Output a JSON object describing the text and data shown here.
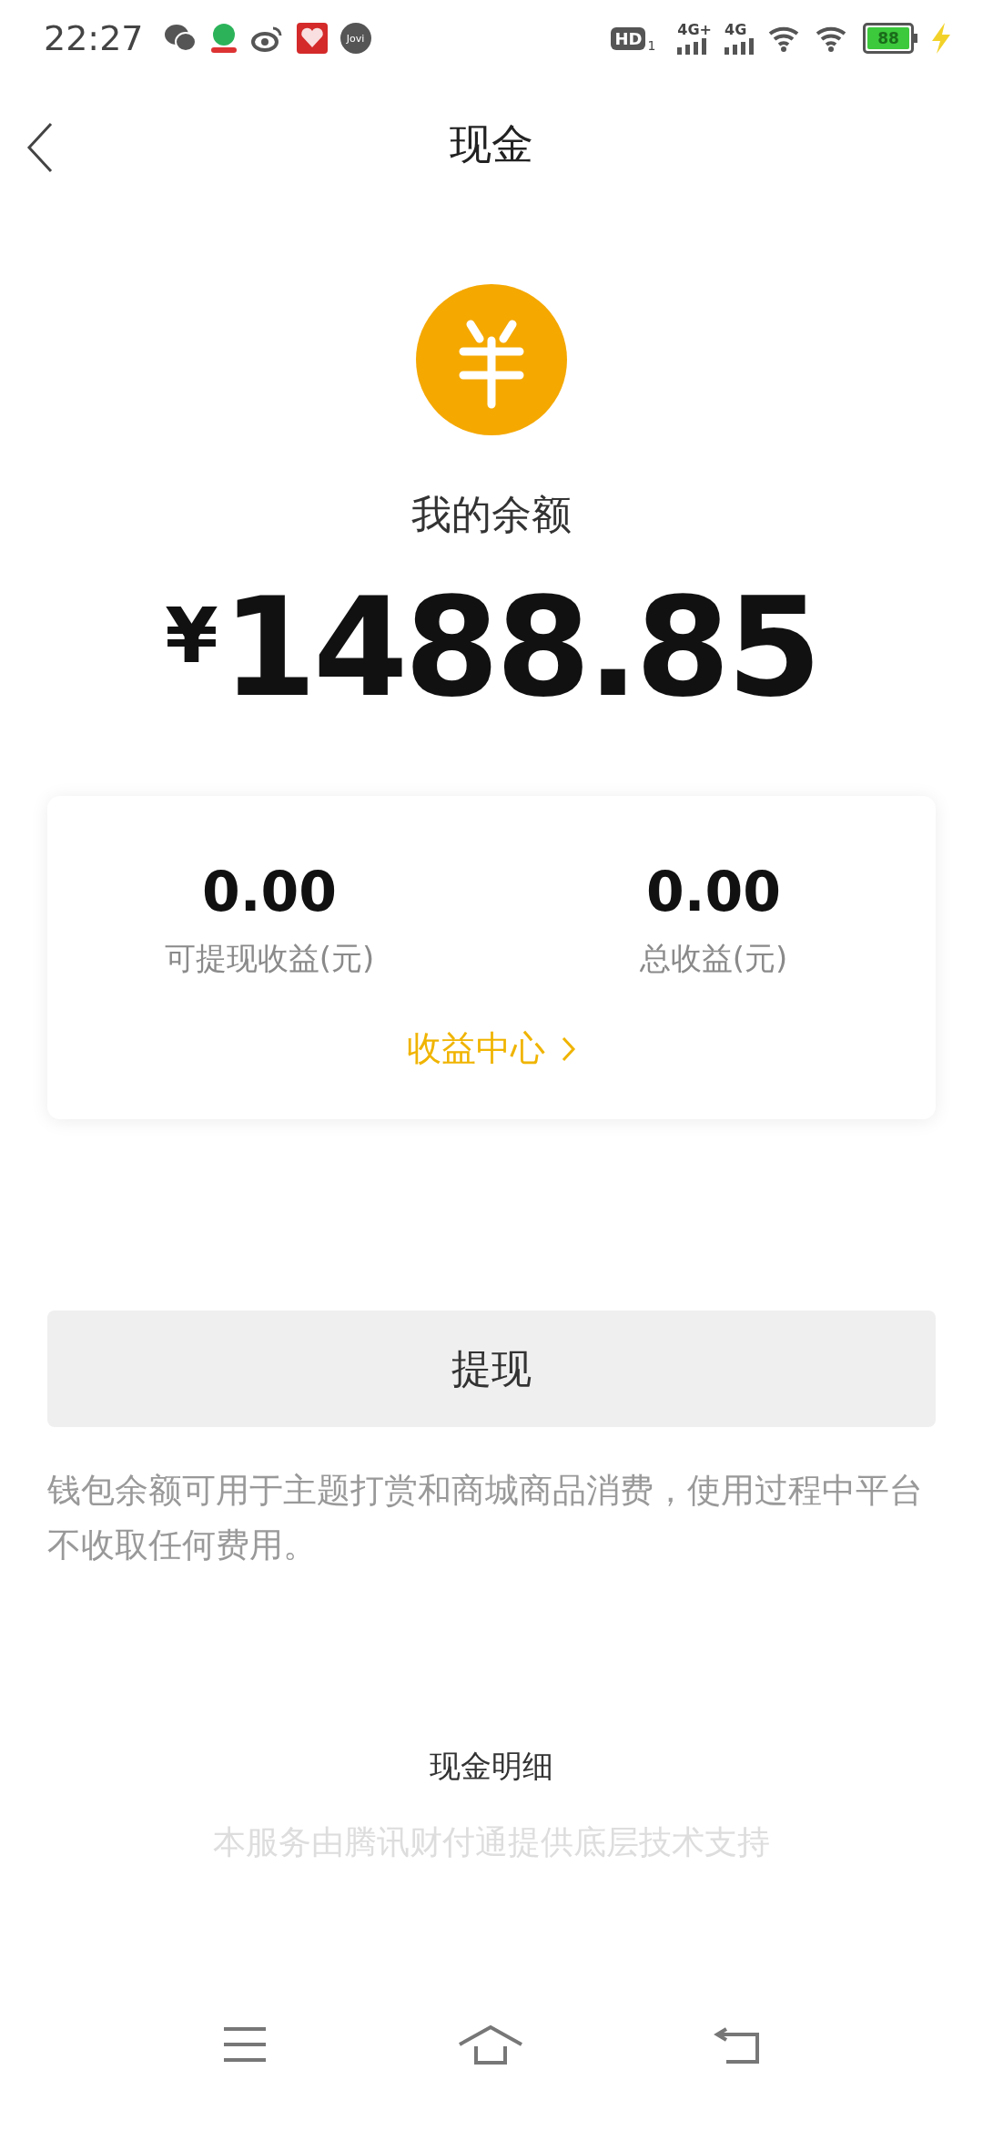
{
  "status_bar": {
    "time": "22:27",
    "jovi": "Jovi",
    "hd": "HD",
    "hd_sim": "1",
    "net1": "4G+",
    "net2": "4G",
    "battery": "88"
  },
  "header": {
    "title": "现金"
  },
  "balance": {
    "label": "我的余额",
    "currency": "¥",
    "amount": "1488.85"
  },
  "earnings": {
    "items": [
      {
        "value": "0.00",
        "label": "可提现收益(元)"
      },
      {
        "value": "0.00",
        "label": "总收益(元)"
      }
    ],
    "link": "收益中心"
  },
  "withdraw_button": "提现",
  "note": "钱包余额可用于主题打赏和商城商品消费，使用过程中平台不收取任何费用。",
  "details_link": "现金明细",
  "disclaimer": "本服务由腾讯财付通提供底层技术支持"
}
